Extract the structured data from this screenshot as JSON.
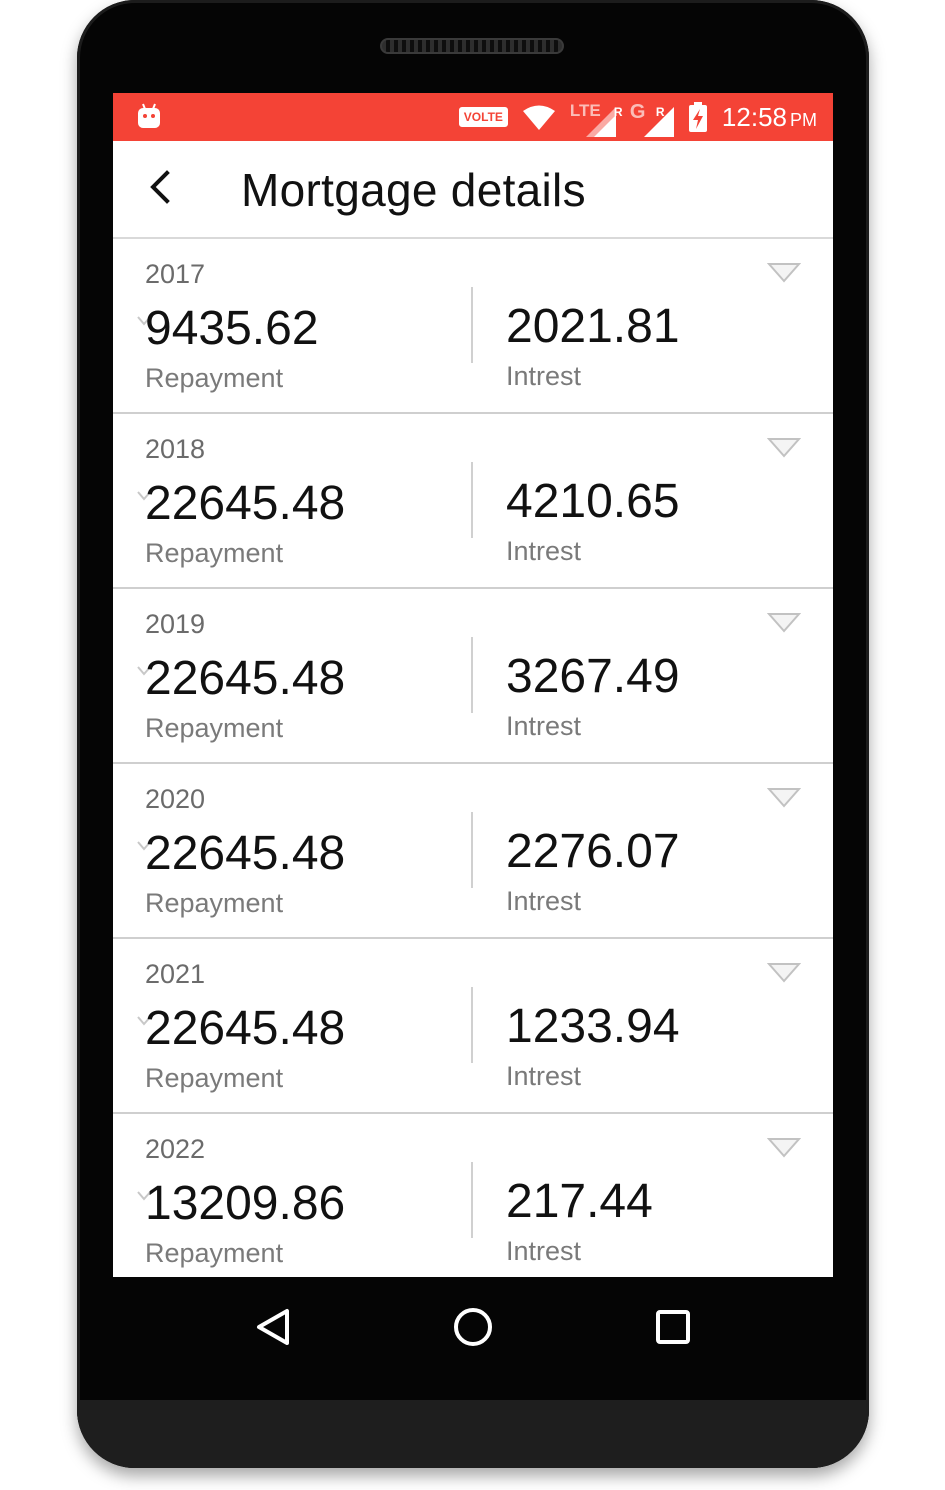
{
  "status_bar": {
    "volte": "VOLTE",
    "network_1": "LTE",
    "roaming_1": "R",
    "network_2": "G",
    "roaming_2": "R",
    "time": "12:58",
    "ampm": "PM",
    "color": "#f44336"
  },
  "app_bar": {
    "title": "Mortgage details",
    "back_icon": "chevron-left-icon"
  },
  "rows": [
    {
      "year": "2017",
      "repayment": "9435.62",
      "repayment_label": "Repayment",
      "interest": "2021.81",
      "interest_label": "Intrest"
    },
    {
      "year": "2018",
      "repayment": "22645.48",
      "repayment_label": "Repayment",
      "interest": "4210.65",
      "interest_label": "Intrest"
    },
    {
      "year": "2019",
      "repayment": "22645.48",
      "repayment_label": "Repayment",
      "interest": "3267.49",
      "interest_label": "Intrest"
    },
    {
      "year": "2020",
      "repayment": "22645.48",
      "repayment_label": "Repayment",
      "interest": "2276.07",
      "interest_label": "Intrest"
    },
    {
      "year": "2021",
      "repayment": "22645.48",
      "repayment_label": "Repayment",
      "interest": "1233.94",
      "interest_label": "Intrest"
    },
    {
      "year": "2022",
      "repayment": "13209.86",
      "repayment_label": "Repayment",
      "interest": "217.44",
      "interest_label": "Intrest"
    }
  ],
  "nav_bar": {
    "back": "triangle-back-icon",
    "home": "circle-home-icon",
    "recents": "square-recents-icon"
  }
}
